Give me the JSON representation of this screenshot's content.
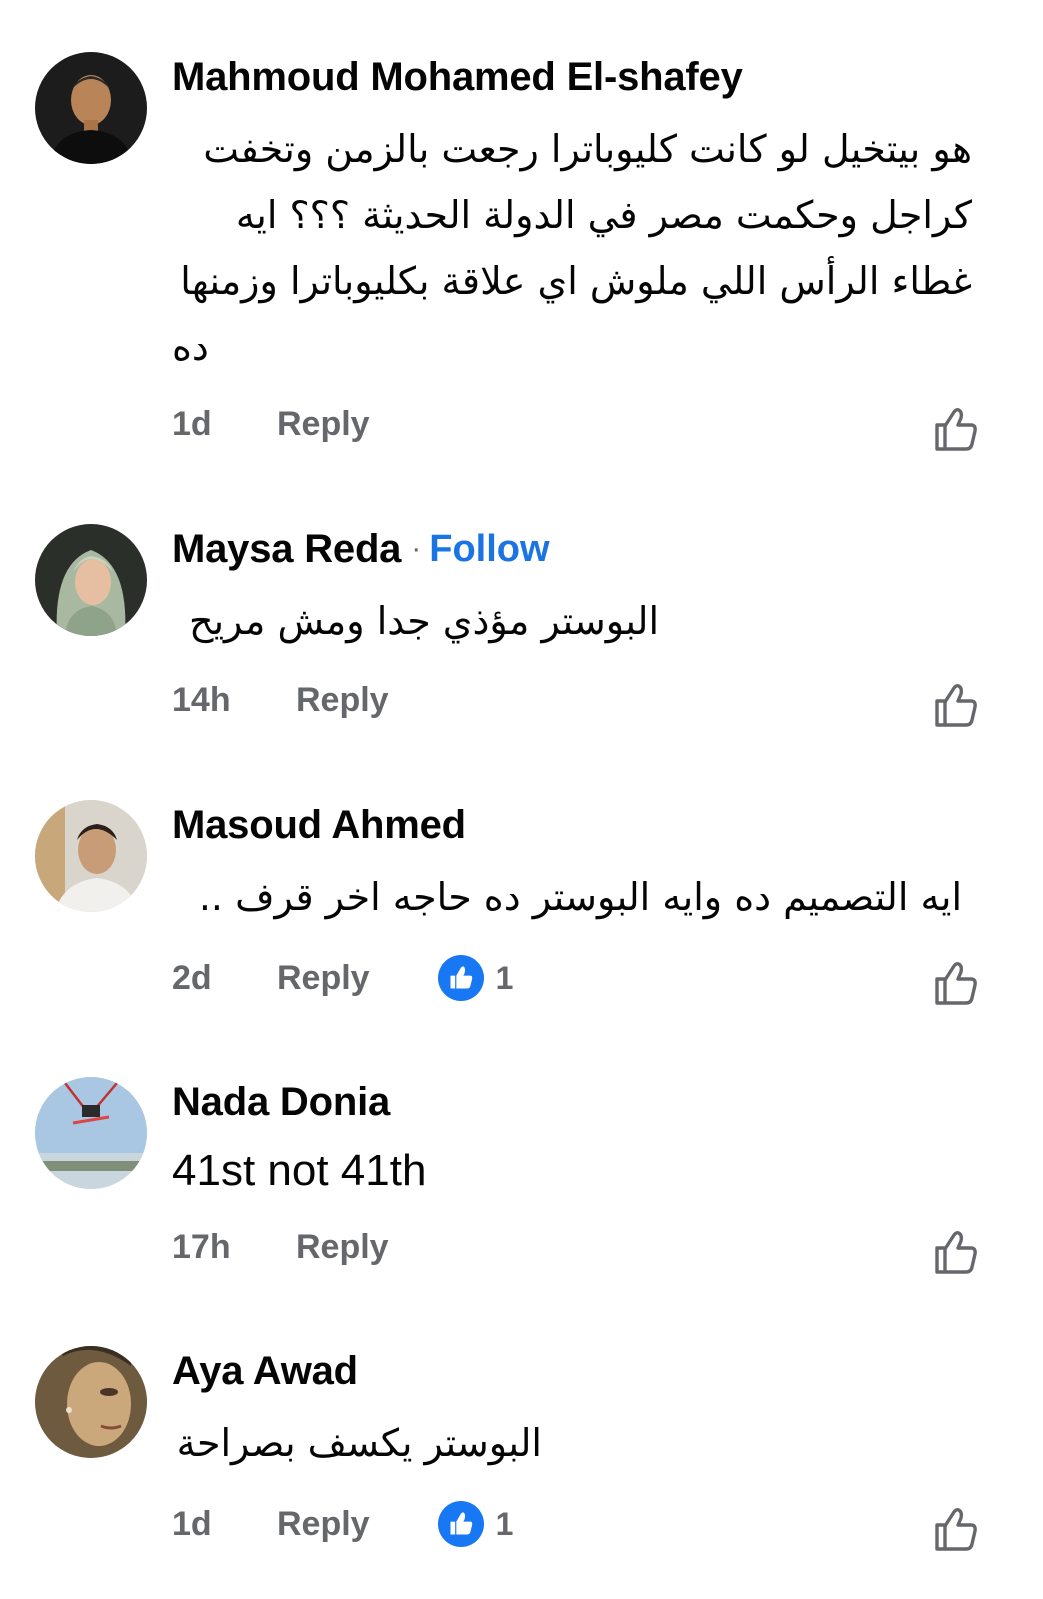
{
  "comments": [
    {
      "author": "Mahmoud Mohamed El-shafey",
      "follow": "",
      "text_lines": [
        "هو بيتخيل لو كانت كليوباترا رجعت بالزمن وتخفت",
        "كراجل وحكمت مصر في الدولة الحديثة ؟؟؟ ايه",
        "غطاء الرأس اللي ملوش اي علاقة بكليوباترا وزمنها",
        "ده"
      ],
      "time": "1d",
      "reply_label": "Reply",
      "reaction_count": "",
      "avatar_icon": "avatar-man-dark-icon"
    },
    {
      "author": "Maysa Reda",
      "follow": "Follow",
      "text_lines": [
        "البوستر مؤذي جدا ومش مريح"
      ],
      "time": "14h",
      "reply_label": "Reply",
      "reaction_count": "",
      "avatar_icon": "avatar-woman-hijab-icon"
    },
    {
      "author": "Masoud Ahmed",
      "follow": "",
      "text_lines": [
        "ايه التصميم ده وايه البوستر ده حاجه اخر قرف .."
      ],
      "time": "2d",
      "reply_label": "Reply",
      "reaction_count": "1",
      "avatar_icon": "avatar-man-light-icon"
    },
    {
      "author": "Nada Donia",
      "follow": "",
      "text_lines": [
        "41st not 41th"
      ],
      "time": "17h",
      "reply_label": "Reply",
      "reaction_count": "",
      "avatar_icon": "avatar-sky-swing-icon"
    },
    {
      "author": "Aya Awad",
      "follow": "",
      "text_lines": [
        "البوستر يكسف بصراحة"
      ],
      "time": "1d",
      "reply_label": "Reply",
      "reaction_count": "1",
      "avatar_icon": "avatar-painting-face-icon"
    }
  ],
  "colors": {
    "link_blue": "#1b74e4",
    "like_badge": "#1877f2",
    "meta_gray": "#65676b",
    "text_black": "#050505"
  },
  "icons": {
    "like_button": "thumbs-up-outline-icon",
    "reaction_badge": "thumbs-up-filled-icon"
  }
}
